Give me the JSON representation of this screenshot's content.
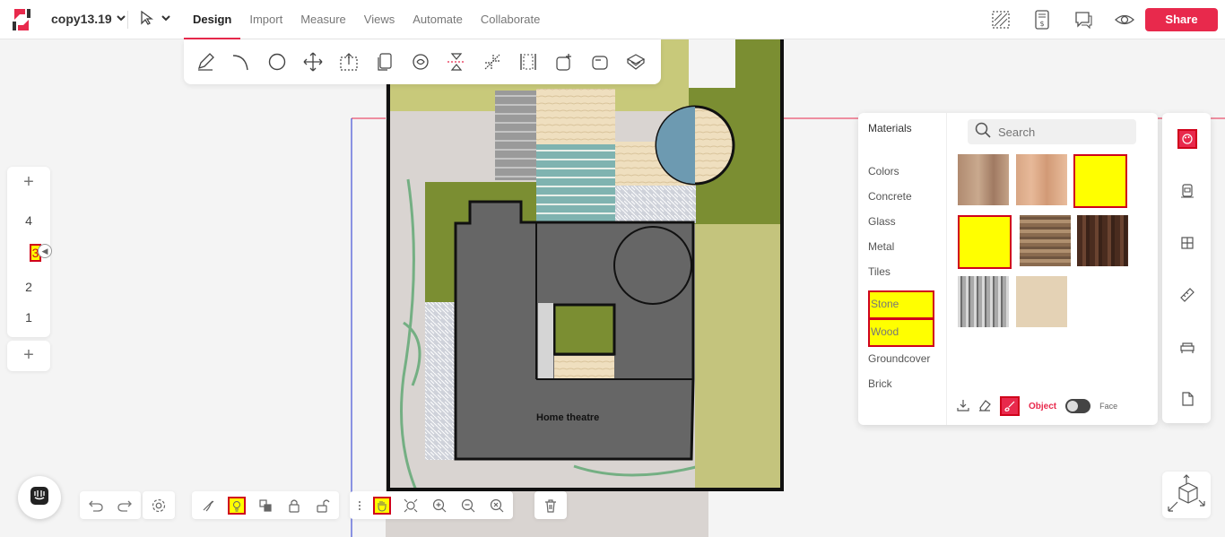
{
  "header": {
    "project_name": "copy13.19",
    "tabs": [
      {
        "label": "Design",
        "active": true
      },
      {
        "label": "Import",
        "active": false
      },
      {
        "label": "Measure",
        "active": false
      },
      {
        "label": "Views",
        "active": false
      },
      {
        "label": "Automate",
        "active": false
      },
      {
        "label": "Collaborate",
        "active": false
      }
    ],
    "share_label": "Share",
    "accent_color": "#e8294c"
  },
  "floors": {
    "items": [
      "4",
      "3",
      "2",
      "1"
    ],
    "active": "3"
  },
  "canvas": {
    "room_label": "Home theatre"
  },
  "materials": {
    "title": "Materials",
    "search_placeholder": "Search",
    "categories": [
      "Colors",
      "Concrete",
      "Glass",
      "Metal",
      "Tiles",
      "Stone",
      "Wood",
      "Groundcover",
      "Brick"
    ],
    "highlighted_categories": [
      "Stone",
      "Wood"
    ],
    "footer": {
      "object_label": "Object",
      "face_label": "Face"
    }
  },
  "icons": {
    "draw_tools": [
      "pencil-icon",
      "arc-icon",
      "circle-icon",
      "move-icon",
      "select-box-icon",
      "copy-icon",
      "rotate-icon",
      "mirror-icon",
      "split-icon",
      "align-icon",
      "add-shape-icon",
      "subtract-shape-icon",
      "extrude-icon"
    ],
    "side_panel": [
      "materials-icon",
      "door-icon",
      "window-icon",
      "ruler-icon",
      "furniture-icon",
      "document-icon"
    ]
  }
}
